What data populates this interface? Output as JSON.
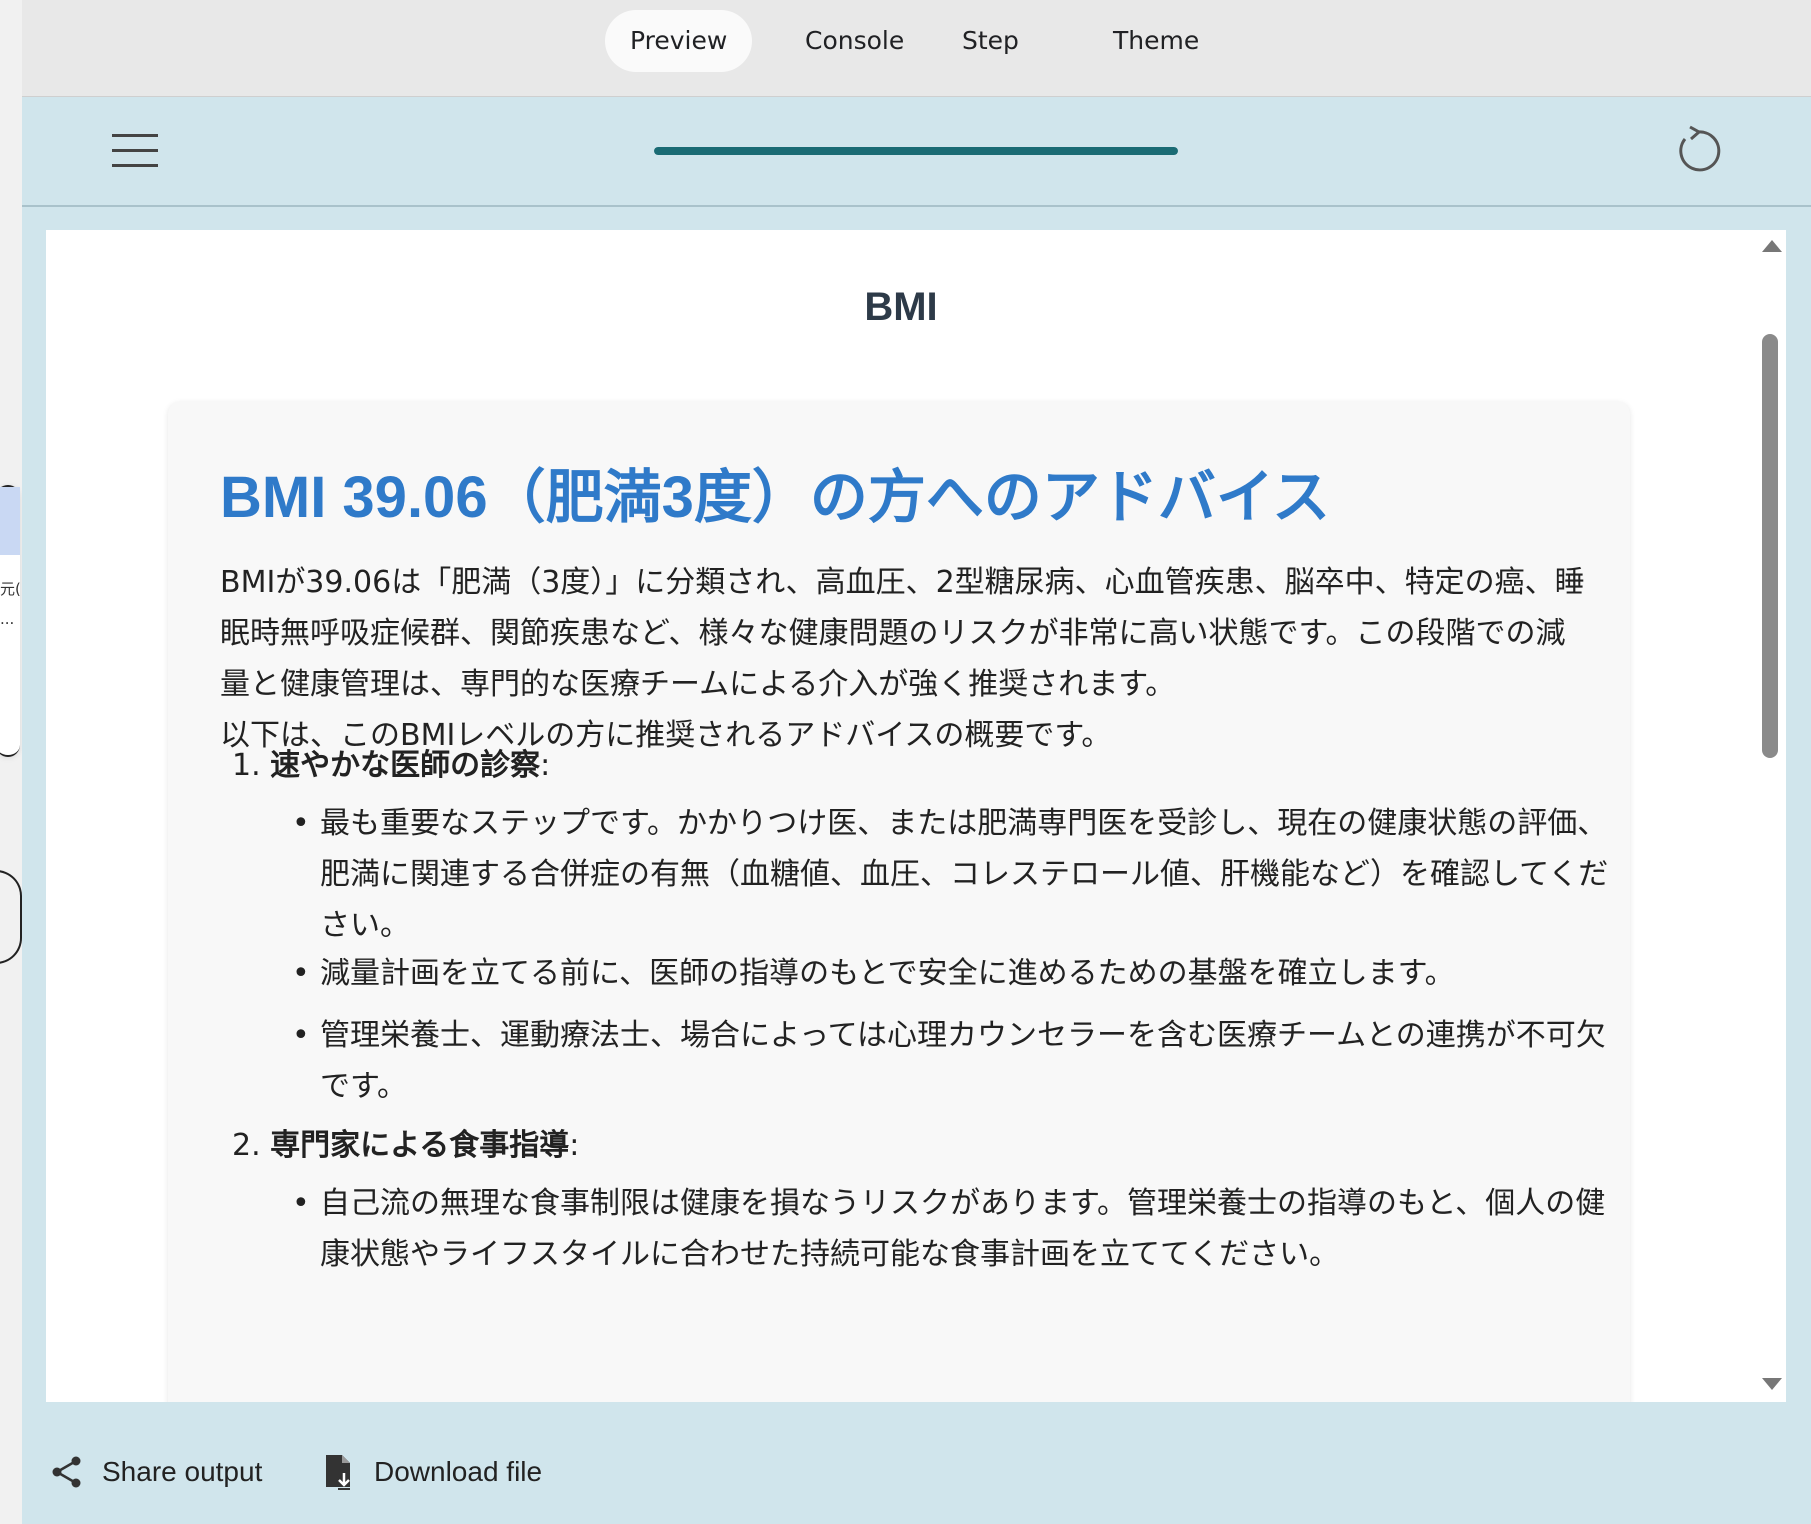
{
  "tabs": [
    {
      "label": "Preview",
      "active": true
    },
    {
      "label": "Console",
      "active": false
    },
    {
      "label": "Step",
      "active": false
    },
    {
      "label": "Theme",
      "active": false
    }
  ],
  "toolbar": {
    "menu_icon": "hamburger-menu-icon",
    "reload_icon": "reload-icon",
    "progress_fraction": 1.0
  },
  "left_window": {
    "fragment_1": "元(",
    "fragment_2": "..."
  },
  "page": {
    "title": "BMI",
    "heading": "BMI 39.06（肥満3度）の方へのアドバイス",
    "intro_1": "BMIが39.06は「肥満（3度）」に分類され、高血圧、2型糖尿病、心血管疾患、脳卒中、特定の癌、睡眠時無呼吸症候群、関節疾患など、様々な健康問題のリスクが非常に高い状態です。この段階での減量と健康管理は、専門的な医療チームによる介入が強く推奨されます。",
    "intro_2": "以下は、このBMIレベルの方に推奨されるアドバイスの概要です。",
    "sections": [
      {
        "number": "1.",
        "title": "速やかな医師の診察",
        "colon": ":",
        "bullets": [
          "最も重要なステップです。かかりつけ医、または肥満専門医を受診し、現在の健康状態の評価、肥満に関連する合併症の有無（血糖値、血圧、コレステロール値、肝機能など）を確認してください。",
          "減量計画を立てる前に、医師の指導のもとで安全に進めるための基盤を確立します。",
          "管理栄養士、運動療法士、場合によっては心理カウンセラーを含む医療チームとの連携が不可欠です。"
        ]
      },
      {
        "number": "2.",
        "title": "専門家による食事指導",
        "colon": ":",
        "bullets": [
          "自己流の無理な食事制限は健康を損なうリスクがあります。管理栄養士の指導のもと、個人の健康状態やライフスタイルに合わせた持続可能な食事計画を立ててください。"
        ]
      }
    ]
  },
  "actions": {
    "share_label": "Share output",
    "share_icon": "share-icon",
    "download_label": "Download file",
    "download_icon": "download-file-icon"
  },
  "colors": {
    "toolbar_bg": "#d0e5ec",
    "progress": "#1a6b74",
    "heading": "#2f7ac9",
    "title": "#2d3a48"
  }
}
